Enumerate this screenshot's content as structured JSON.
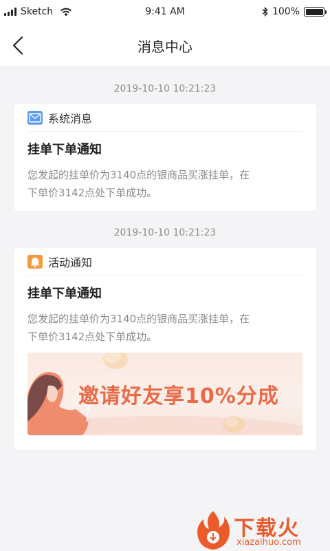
{
  "status_bar": {
    "carrier": "Sketch",
    "time": "9:41 AM",
    "battery": "100%"
  },
  "nav": {
    "title": "消息中心"
  },
  "messages": [
    {
      "timestamp": "2019-10-10  10:21:23",
      "category": "系统消息",
      "category_icon": "mail-icon",
      "title": "挂单下单通知",
      "body_line1": "您发起的挂单价为3140点的银商品买涨挂单，在",
      "body_line2": "下单价3142点处下单成功。"
    },
    {
      "timestamp": "2019-10-10  10:21:23",
      "category": "活动通知",
      "category_icon": "bell-icon",
      "title": "挂单下单通知",
      "body_line1": "您发起的挂单价为3140点的银商品买涨挂单，在",
      "body_line2": "下单价3142点处下单成功。",
      "banner_text": "邀请好友享10%分成"
    }
  ],
  "watermark": {
    "title": "下载火",
    "url": "xiazaihuo.com"
  },
  "colors": {
    "accent_orange": "#ea6b48",
    "mail_blue": "#5b9bf5",
    "bell_orange": "#f49a3c"
  }
}
